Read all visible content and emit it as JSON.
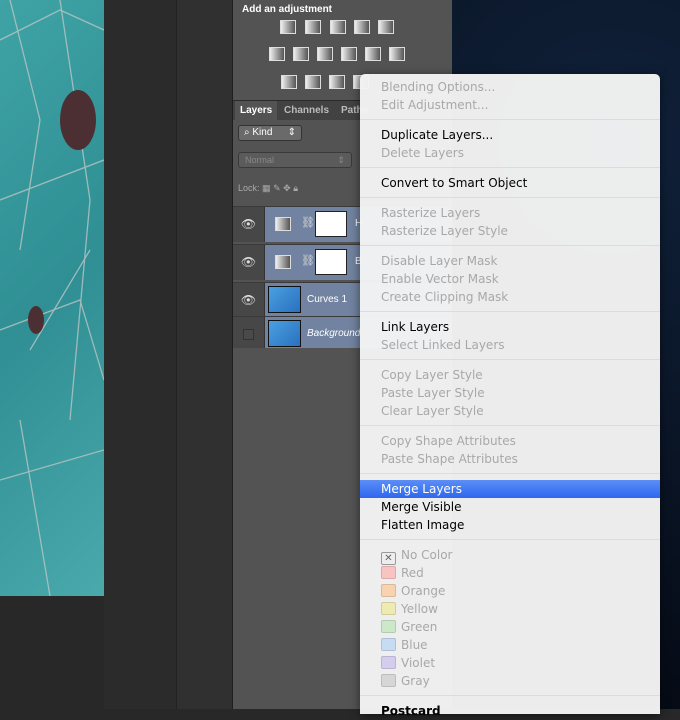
{
  "adjustments": {
    "title": "Add an adjustment"
  },
  "layers_panel": {
    "tabs": [
      {
        "label": "Layers"
      },
      {
        "label": "Channels"
      },
      {
        "label": "Paths"
      }
    ],
    "filter_kind": "Kind",
    "blend_mode": "Normal",
    "lock_label": "Lock:",
    "layers": [
      {
        "name": "H",
        "visible": true,
        "type": "adjustment"
      },
      {
        "name": "B",
        "visible": true,
        "type": "adjustment"
      },
      {
        "name": "Curves 1",
        "visible": true,
        "type": "pixel"
      },
      {
        "name": "Background",
        "visible": false,
        "type": "pixel"
      }
    ]
  },
  "context_menu": {
    "groups": [
      [
        {
          "label": "Blending Options...",
          "enabled": false
        },
        {
          "label": "Edit Adjustment...",
          "enabled": false
        }
      ],
      [
        {
          "label": "Duplicate Layers...",
          "enabled": true
        },
        {
          "label": "Delete Layers",
          "enabled": false
        }
      ],
      [
        {
          "label": "Convert to Smart Object",
          "enabled": true
        }
      ],
      [
        {
          "label": "Rasterize Layers",
          "enabled": false
        },
        {
          "label": "Rasterize Layer Style",
          "enabled": false
        }
      ],
      [
        {
          "label": "Disable Layer Mask",
          "enabled": false
        },
        {
          "label": "Enable Vector Mask",
          "enabled": false
        },
        {
          "label": "Create Clipping Mask",
          "enabled": false
        }
      ],
      [
        {
          "label": "Link Layers",
          "enabled": true
        },
        {
          "label": "Select Linked Layers",
          "enabled": false
        }
      ],
      [
        {
          "label": "Copy Layer Style",
          "enabled": false
        },
        {
          "label": "Paste Layer Style",
          "enabled": false
        },
        {
          "label": "Clear Layer Style",
          "enabled": false
        }
      ],
      [
        {
          "label": "Copy Shape Attributes",
          "enabled": false
        },
        {
          "label": "Paste Shape Attributes",
          "enabled": false
        }
      ],
      [
        {
          "label": "Merge Layers",
          "enabled": true,
          "highlighted": true
        },
        {
          "label": "Merge Visible",
          "enabled": true
        },
        {
          "label": "Flatten Image",
          "enabled": true
        }
      ]
    ],
    "colors": [
      {
        "label": "No Color",
        "color": null
      },
      {
        "label": "Red",
        "color": "#f8c4c2"
      },
      {
        "label": "Orange",
        "color": "#f7d3b0"
      },
      {
        "label": "Yellow",
        "color": "#eeeab2"
      },
      {
        "label": "Green",
        "color": "#cde8c8"
      },
      {
        "label": "Blue",
        "color": "#c6dcf3"
      },
      {
        "label": "Violet",
        "color": "#d5cdee"
      },
      {
        "label": "Gray",
        "color": "#d6d6d6"
      }
    ],
    "last_item": "Postcard"
  }
}
